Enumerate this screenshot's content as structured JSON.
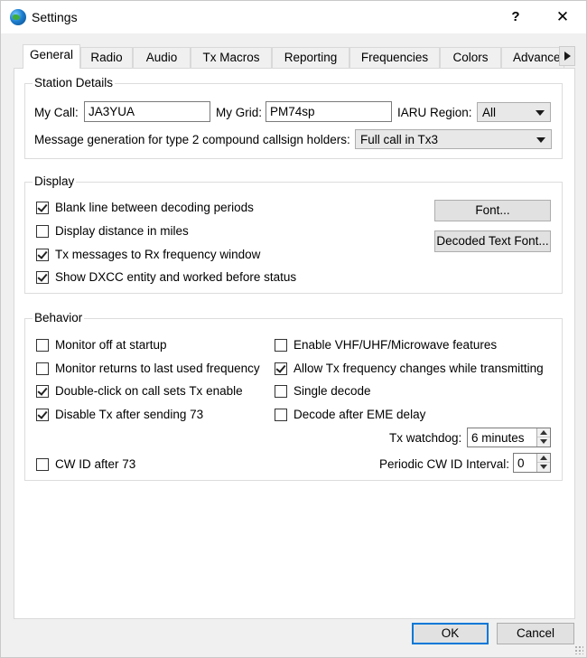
{
  "window": {
    "title": "Settings",
    "help_label": "?",
    "close_label": "✕"
  },
  "tabs": [
    {
      "label": "General"
    },
    {
      "label": "Radio"
    },
    {
      "label": "Audio"
    },
    {
      "label": "Tx Macros"
    },
    {
      "label": "Reporting"
    },
    {
      "label": "Frequencies"
    },
    {
      "label": "Colors"
    },
    {
      "label": "Advanced"
    }
  ],
  "station": {
    "group_title": "Station Details",
    "my_call_label": "My Call:",
    "my_call_value": "JA3YUA",
    "my_grid_label": "My Grid:",
    "my_grid_value": "PM74sp",
    "iaru_label": "IARU Region:",
    "iaru_value": "All",
    "msg_gen_label": "Message generation for type 2 compound callsign holders:",
    "msg_gen_value": "Full call in Tx3"
  },
  "display": {
    "group_title": "Display",
    "checks": [
      {
        "label": "Blank line between decoding periods",
        "checked": true
      },
      {
        "label": "Display distance in miles",
        "checked": false
      },
      {
        "label": "Tx messages to Rx frequency window",
        "checked": true
      },
      {
        "label": "Show DXCC entity and worked before status",
        "checked": true
      }
    ],
    "font_button": "Font...",
    "decoded_font_button": "Decoded Text Font..."
  },
  "behavior": {
    "group_title": "Behavior",
    "left_checks": [
      {
        "label": "Monitor off at startup",
        "checked": false
      },
      {
        "label": "Monitor returns to last used frequency",
        "checked": false
      },
      {
        "label": "Double-click on call sets Tx enable",
        "checked": true
      },
      {
        "label": "Disable Tx after sending 73",
        "checked": true
      }
    ],
    "right_checks": [
      {
        "label": "Enable VHF/UHF/Microwave features",
        "checked": false
      },
      {
        "label": "Allow Tx frequency changes while transmitting",
        "checked": true
      },
      {
        "label": "Single decode",
        "checked": false
      },
      {
        "label": "Decode after EME delay",
        "checked": false
      }
    ],
    "tx_watchdog_label": "Tx watchdog:",
    "tx_watchdog_value": "6 minutes",
    "cw_id_label": "CW ID after 73",
    "cw_id_checked": false,
    "cw_interval_label": "Periodic CW ID Interval:",
    "cw_interval_value": "0"
  },
  "footer": {
    "ok_label": "OK",
    "cancel_label": "Cancel"
  }
}
